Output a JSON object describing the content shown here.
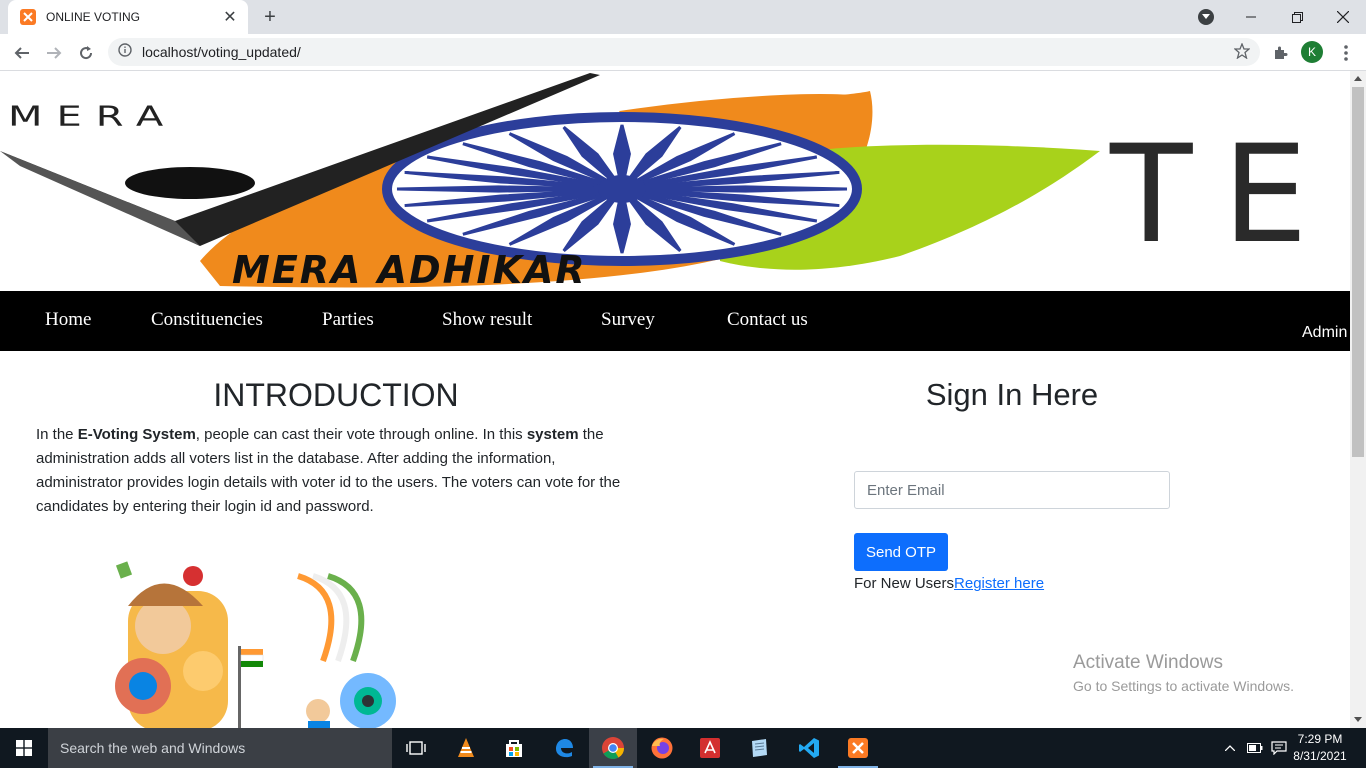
{
  "browser": {
    "tab_title": "ONLINE VOTING",
    "url": "localhost/voting_updated/",
    "profile_initial": "K"
  },
  "banner": {
    "logo_text_top": "MERA",
    "logo_text_right": "TE",
    "tagline": "MERA ADHIKAR"
  },
  "nav": {
    "items": [
      "Home",
      "Constituencies",
      "Parties",
      "Show result",
      "Survey",
      "Contact us"
    ],
    "admin": "Admin"
  },
  "intro": {
    "title": "INTRODUCTION",
    "p1": "In the ",
    "b1": "E-Voting System",
    "p2": ", people can cast their vote through online. In this ",
    "b2": "system",
    "p3": " the administration adds all voters list in the database. After adding the information, administrator provides login details with voter id to the users. The voters can vote for the candidates by entering their login id and password."
  },
  "signin": {
    "title": "Sign In Here",
    "email_placeholder": "Enter Email",
    "button": "Send OTP",
    "new_users": "For New Users",
    "register_link": "Register here"
  },
  "watermark": {
    "line1": "Activate Windows",
    "line2": "Go to Settings to activate Windows."
  },
  "taskbar": {
    "search_placeholder": "Search the web and Windows",
    "time": "7:29 PM",
    "date": "8/31/2021"
  },
  "colors": {
    "accent": "#0d6efd",
    "navbar": "#000000",
    "saffron": "#f08a1c",
    "green": "#a8d21b",
    "chakra": "#2c3e9a"
  }
}
